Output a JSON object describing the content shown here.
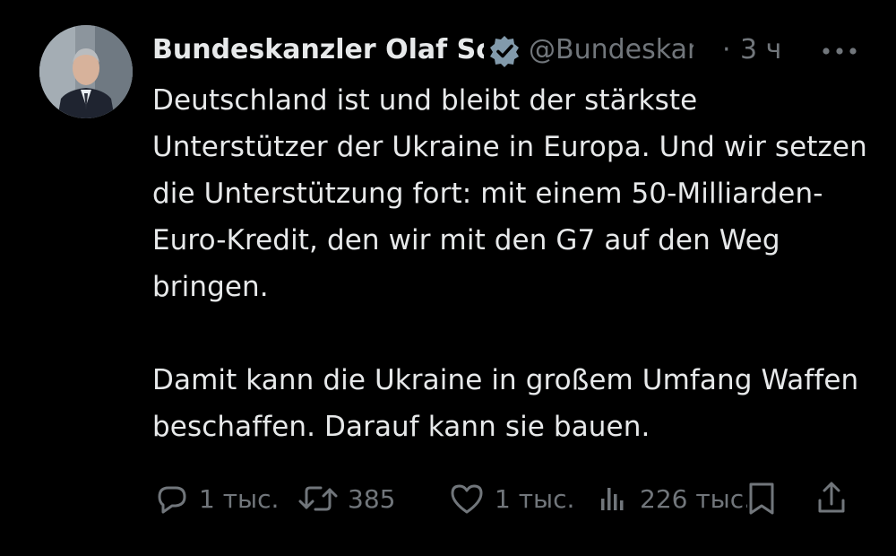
{
  "author": {
    "display_name": "Bundeskanzler Olaf Scholz",
    "handle": "@Bundeskanzler",
    "separator": "·",
    "time": "3 ч",
    "verified": true,
    "avatar_icon": "profile-photo"
  },
  "body": {
    "text": "Deutschland ist und bleibt der stärkste Unterstützer der Ukraine in Europa. Und wir setzen die Unterstützung fort: mit einem 50-Milliarden-Euro-Kredit, den wir mit den G7 auf den Weg bringen.\n\nDamit kann die Ukraine in großem Umfang Waffen beschaffen. Darauf kann sie bauen."
  },
  "actions": {
    "reply": {
      "icon": "reply-icon",
      "count": "1 тыс."
    },
    "retweet": {
      "icon": "retweet-icon",
      "count": "385"
    },
    "like": {
      "icon": "heart-icon",
      "count": "1 тыс."
    },
    "views": {
      "icon": "views-icon",
      "count": "226 тыс."
    },
    "bookmark": {
      "icon": "bookmark-icon"
    },
    "share": {
      "icon": "share-icon"
    }
  },
  "colors": {
    "background": "#000000",
    "text": "#e7e9ea",
    "secondary": "#71767b",
    "verified_badge": "#829aab"
  }
}
